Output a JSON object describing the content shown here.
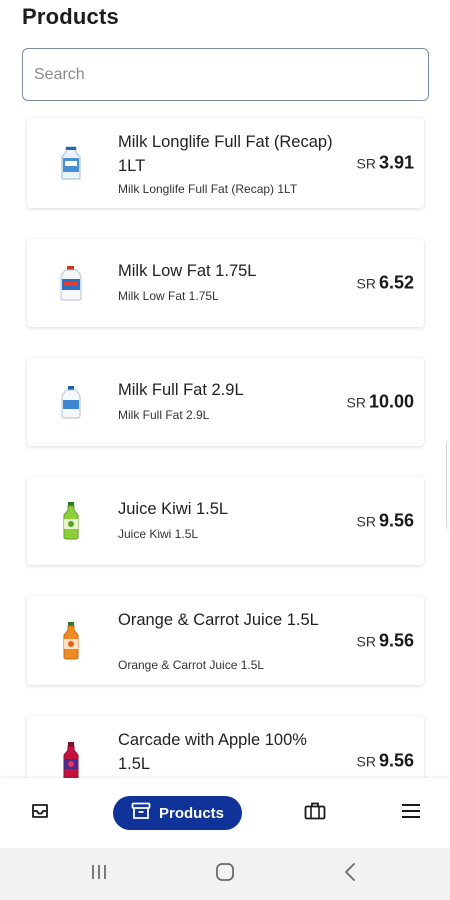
{
  "header": {
    "title": "Products"
  },
  "search": {
    "placeholder": "Search",
    "value": ""
  },
  "products": [
    {
      "name": "Milk Longlife Full Fat (Recap) 1LT",
      "subtitle": "Milk Longlife Full Fat (Recap) 1LT",
      "currency": "SR",
      "price": "3.91",
      "icon": "milk-carton-icon"
    },
    {
      "name": "Milk Low Fat 1.75L",
      "subtitle": "Milk Low Fat 1.75L",
      "currency": "SR",
      "price": "6.52",
      "icon": "milk-jug-icon"
    },
    {
      "name": "Milk Full Fat 2.9L",
      "subtitle": "Milk Full Fat 2.9L",
      "currency": "SR",
      "price": "10.00",
      "icon": "milk-jug-icon"
    },
    {
      "name": "Juice Kiwi 1.5L",
      "subtitle": "Juice Kiwi 1.5L",
      "currency": "SR",
      "price": "9.56",
      "icon": "juice-bottle-icon"
    },
    {
      "name": "Orange & Carrot Juice 1.5L",
      "subtitle": "Orange & Carrot Juice 1.5L",
      "currency": "SR",
      "price": "9.56",
      "icon": "juice-bottle-icon"
    },
    {
      "name": "Carcade with Apple 100% 1.5L",
      "subtitle": "",
      "currency": "SR",
      "price": "9.56",
      "icon": "juice-bottle-icon"
    }
  ],
  "bottom_nav": {
    "items": [
      {
        "icon": "inbox-icon",
        "label": ""
      },
      {
        "icon": "archive-box-icon",
        "label": "Products",
        "active": true
      },
      {
        "icon": "briefcase-icon",
        "label": ""
      },
      {
        "icon": "menu-icon",
        "label": ""
      }
    ],
    "active_color": "#10339a"
  },
  "system_nav": {
    "items": [
      "recent-apps-icon",
      "home-icon",
      "back-icon"
    ]
  }
}
